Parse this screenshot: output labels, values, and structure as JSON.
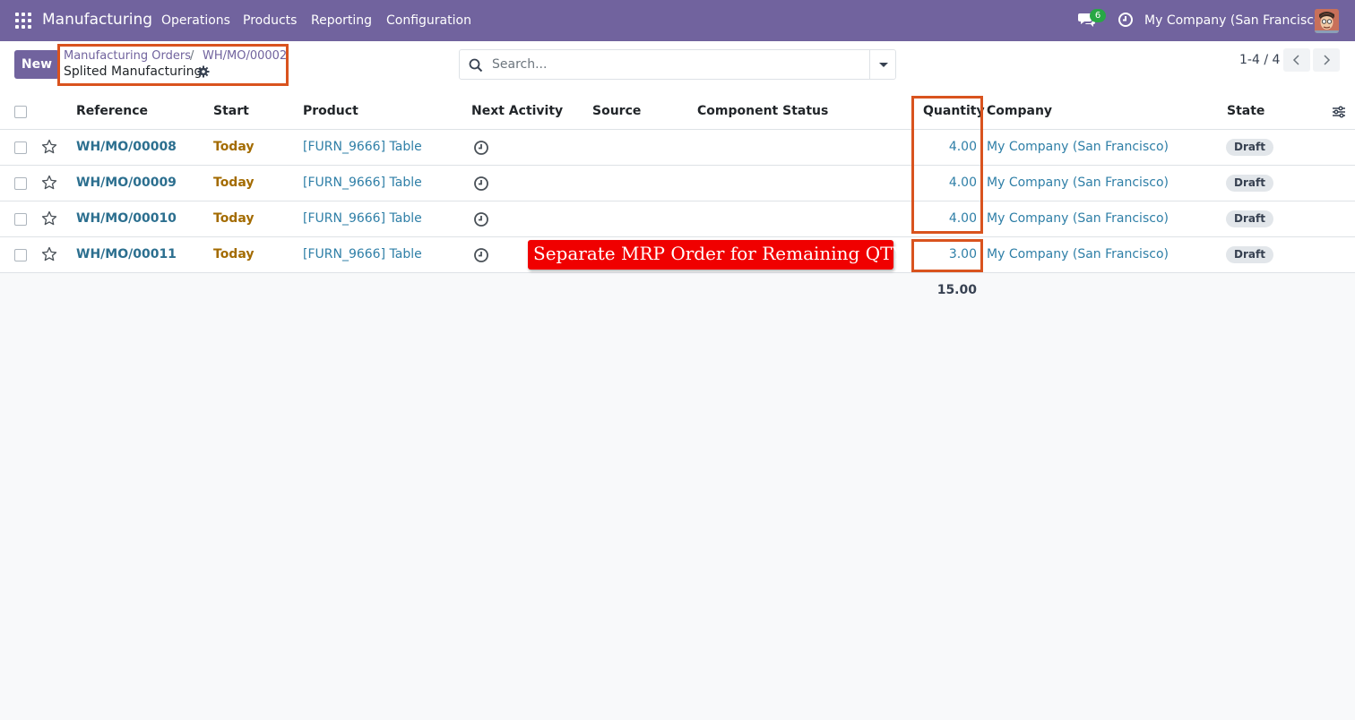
{
  "navbar": {
    "app_name": "Manufacturing",
    "menus": [
      "Operations",
      "Products",
      "Reporting",
      "Configuration"
    ],
    "message_count": "6",
    "company": "My Company (San Francisco)",
    "color": "#71639e"
  },
  "control_panel": {
    "new_label": "New",
    "breadcrumb": [
      "Manufacturing Orders",
      "WH/MO/00002"
    ],
    "breadcrumb_separator": "/",
    "current": "Splited Manufacturing",
    "search_placeholder": "Search...",
    "pager": "1-4 / 4"
  },
  "table": {
    "columns": [
      "Reference",
      "Start",
      "Product",
      "Next Activity",
      "Source",
      "Component Status",
      "Quantity",
      "Company",
      "State"
    ],
    "rows": [
      {
        "reference": "WH/MO/00008",
        "start": "Today",
        "product": "[FURN_9666] Table",
        "source": "",
        "component_status": "",
        "quantity": "4.00",
        "company": "My Company (San Francisco)",
        "state": "Draft"
      },
      {
        "reference": "WH/MO/00009",
        "start": "Today",
        "product": "[FURN_9666] Table",
        "source": "",
        "component_status": "",
        "quantity": "4.00",
        "company": "My Company (San Francisco)",
        "state": "Draft"
      },
      {
        "reference": "WH/MO/00010",
        "start": "Today",
        "product": "[FURN_9666] Table",
        "source": "",
        "component_status": "",
        "quantity": "4.00",
        "company": "My Company (San Francisco)",
        "state": "Draft"
      },
      {
        "reference": "WH/MO/00011",
        "start": "Today",
        "product": "[FURN_9666] Table",
        "source": "",
        "component_status": "",
        "quantity": "3.00",
        "company": "My Company (San Francisco)",
        "state": "Draft"
      }
    ],
    "total_quantity": "15.00"
  },
  "annotation": {
    "callout_text": "Separate MRP Order for Remaining QTY",
    "highlight_color": "#d9531e",
    "callout_color": "#f00000"
  }
}
